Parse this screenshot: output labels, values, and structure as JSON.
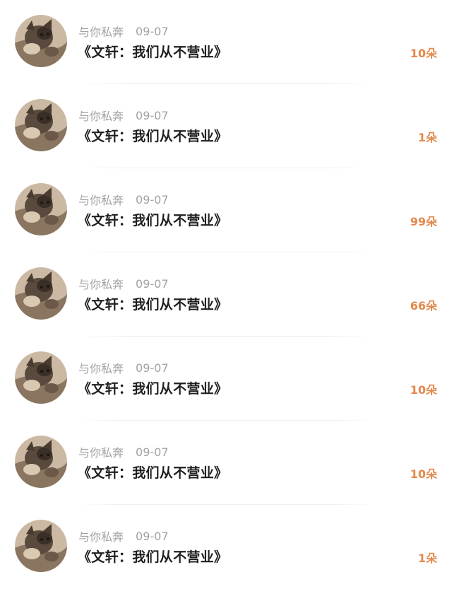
{
  "comments": [
    {
      "user_name": "与你私奔",
      "date": "09-07",
      "text": "《文轩：我们从不营业》",
      "gift": "10朵",
      "avatar": "cat-avatar-icon"
    },
    {
      "user_name": "与你私奔",
      "date": "09-07",
      "text": "《文轩：我们从不营业》",
      "gift": "1朵",
      "avatar": "cat-avatar-icon"
    },
    {
      "user_name": "与你私奔",
      "date": "09-07",
      "text": "《文轩：我们从不营业》",
      "gift": "99朵",
      "avatar": "cat-avatar-icon"
    },
    {
      "user_name": "与你私奔",
      "date": "09-07",
      "text": "《文轩：我们从不营业》",
      "gift": "66朵",
      "avatar": "cat-avatar-icon"
    },
    {
      "user_name": "与你私奔",
      "date": "09-07",
      "text": "《文轩：我们从不营业》",
      "gift": "10朵",
      "avatar": "cat-avatar-icon"
    },
    {
      "user_name": "与你私奔",
      "date": "09-07",
      "text": "《文轩：我们从不营业》",
      "gift": "10朵",
      "avatar": "cat-avatar-icon"
    },
    {
      "user_name": "与你私奔",
      "date": "09-07",
      "text": "《文轩：我们从不营业》",
      "gift": "1朵",
      "avatar": "cat-avatar-icon"
    }
  ],
  "colors": {
    "gift_count": "#e3894c",
    "meta_text": "#a2a2a2",
    "title_text": "#1f1f1f",
    "divider": "#eeeeee"
  }
}
